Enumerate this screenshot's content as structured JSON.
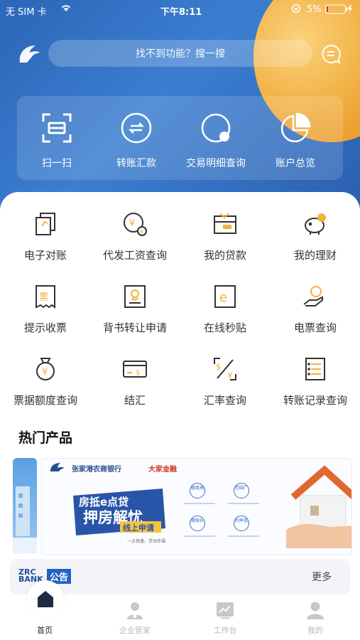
{
  "status_bar": {
    "carrier": "无 SIM 卡",
    "time": "下午8:11",
    "battery": "5%"
  },
  "header": {
    "search_placeholder": "找不到功能？搜一搜"
  },
  "quick_actions": [
    {
      "label": "扫一扫",
      "icon": "scan-icon"
    },
    {
      "label": "转账汇款",
      "icon": "transfer-icon"
    },
    {
      "label": "交易明细查询",
      "icon": "transaction-detail-icon"
    },
    {
      "label": "账户总览",
      "icon": "pie-chart-icon"
    }
  ],
  "grid": [
    {
      "label": "电子对账",
      "icon": "documents-icon"
    },
    {
      "label": "代发工资查询",
      "icon": "salary-coin-icon"
    },
    {
      "label": "我的贷款",
      "icon": "loan-icon"
    },
    {
      "label": "我的理财",
      "icon": "piggy-bank-icon"
    },
    {
      "label": "提示收票",
      "icon": "receipt-icon"
    },
    {
      "label": "背书转让申请",
      "icon": "endorsement-icon"
    },
    {
      "label": "在线秒贴",
      "icon": "e-discount-icon"
    },
    {
      "label": "电票查询",
      "icon": "hand-coin-icon"
    },
    {
      "label": "票据额度查询",
      "icon": "money-bag-icon"
    },
    {
      "label": "结汇",
      "icon": "card-dollar-icon"
    },
    {
      "label": "汇率查询",
      "icon": "exchange-rate-icon"
    },
    {
      "label": "转账记录查询",
      "icon": "list-record-icon"
    }
  ],
  "hot_products": {
    "title": "热门产品",
    "banner": {
      "bank_name": "张家港农商银行",
      "partner": "大家金融",
      "promo_line1": "房抵e点贷",
      "promo_line2": "押房解忧",
      "promo_line3": "线上申请",
      "promo_foot": "一点快速，贷动幸福",
      "features": [
        "额度高",
        "范围广",
        "期限长",
        "利率低"
      ]
    }
  },
  "notice": {
    "brand_line1": "ZRC",
    "brand_line2": "BANK",
    "tag": "公告",
    "more": "更多"
  },
  "tabbar": [
    {
      "label": "首页",
      "icon": "home-icon",
      "active": true
    },
    {
      "label": "企业管家",
      "icon": "manager-icon",
      "active": false
    },
    {
      "label": "工作台",
      "icon": "workbench-chart-icon",
      "active": false
    },
    {
      "label": "我的",
      "icon": "profile-icon",
      "active": false
    }
  ],
  "colors": {
    "header_blue": "#2c66b8",
    "accent_orange": "#f5b343",
    "icon_gold": "#f2b33a",
    "tab_active": "#1f2a44"
  }
}
